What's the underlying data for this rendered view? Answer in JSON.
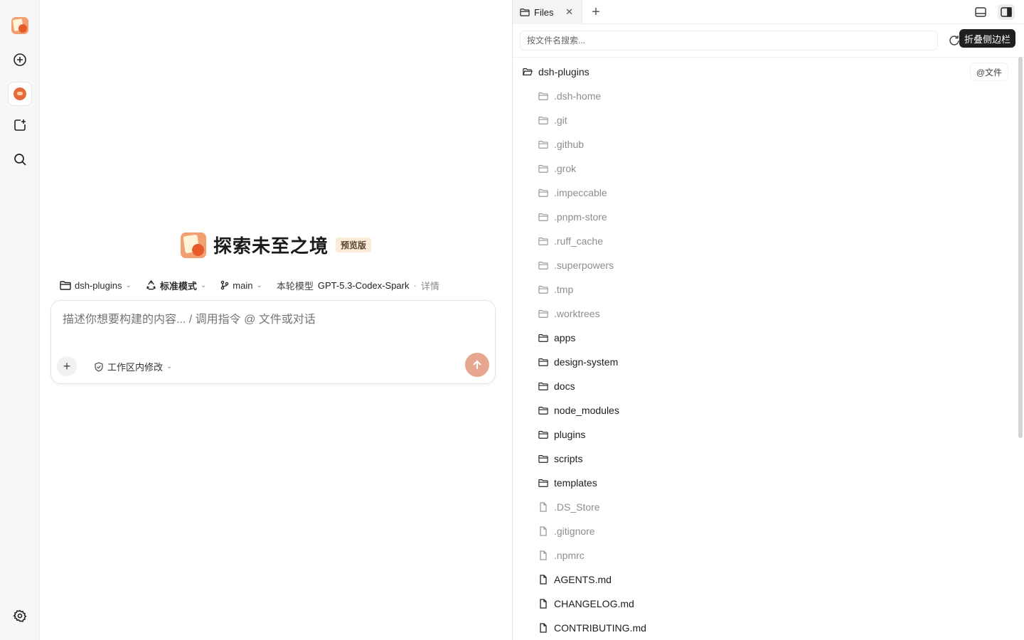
{
  "app": {
    "title": "探索未至之境",
    "badge": "预览版"
  },
  "rail": {
    "items": [
      {
        "icon": "app-logo-icon"
      },
      {
        "icon": "new-chat-icon"
      },
      {
        "icon": "avatar-icon"
      },
      {
        "icon": "new-project-icon"
      },
      {
        "icon": "search-icon"
      },
      {
        "icon": "gear-icon"
      }
    ]
  },
  "context_bar": {
    "project": "dsh-plugins",
    "mode": "标准模式",
    "branch": "main",
    "model_label": "本轮模型",
    "model_name": "GPT-5.3-Codex-Spark",
    "separator": "·",
    "detail": "详情"
  },
  "composer": {
    "placeholder": "描述你想要构建的内容... / 调用指令 @ 文件或对话",
    "scope": "工作区内修改"
  },
  "panel": {
    "tab_label": "Files",
    "search_placeholder": "按文件名搜索...",
    "tooltip": "折叠侧边栏",
    "root": "dsh-plugins",
    "at_file": "@文件",
    "entries": [
      {
        "name": ".dsh-home",
        "type": "folder",
        "dim": true
      },
      {
        "name": ".git",
        "type": "folder",
        "dim": true
      },
      {
        "name": ".github",
        "type": "folder",
        "dim": true
      },
      {
        "name": ".grok",
        "type": "folder",
        "dim": true
      },
      {
        "name": ".impeccable",
        "type": "folder",
        "dim": true
      },
      {
        "name": ".pnpm-store",
        "type": "folder",
        "dim": true
      },
      {
        "name": ".ruff_cache",
        "type": "folder",
        "dim": true
      },
      {
        "name": ".superpowers",
        "type": "folder",
        "dim": true
      },
      {
        "name": ".tmp",
        "type": "folder",
        "dim": true
      },
      {
        "name": ".worktrees",
        "type": "folder",
        "dim": true
      },
      {
        "name": "apps",
        "type": "folder",
        "dim": false
      },
      {
        "name": "design-system",
        "type": "folder",
        "dim": false
      },
      {
        "name": "docs",
        "type": "folder",
        "dim": false
      },
      {
        "name": "node_modules",
        "type": "folder",
        "dim": false
      },
      {
        "name": "plugins",
        "type": "folder",
        "dim": false
      },
      {
        "name": "scripts",
        "type": "folder",
        "dim": false
      },
      {
        "name": "templates",
        "type": "folder",
        "dim": false
      },
      {
        "name": ".DS_Store",
        "type": "file",
        "dim": true
      },
      {
        "name": ".gitignore",
        "type": "file",
        "dim": true
      },
      {
        "name": ".npmrc",
        "type": "file",
        "dim": true
      },
      {
        "name": "AGENTS.md",
        "type": "file",
        "dim": false
      },
      {
        "name": "CHANGELOG.md",
        "type": "file",
        "dim": false
      },
      {
        "name": "CONTRIBUTING.md",
        "type": "file",
        "dim": false
      }
    ]
  },
  "colors": {
    "accent": "#e6a690",
    "badge_bg": "#fbecd9",
    "tooltip_bg": "#1f1f1f",
    "dim_text": "#8d8d8d"
  }
}
